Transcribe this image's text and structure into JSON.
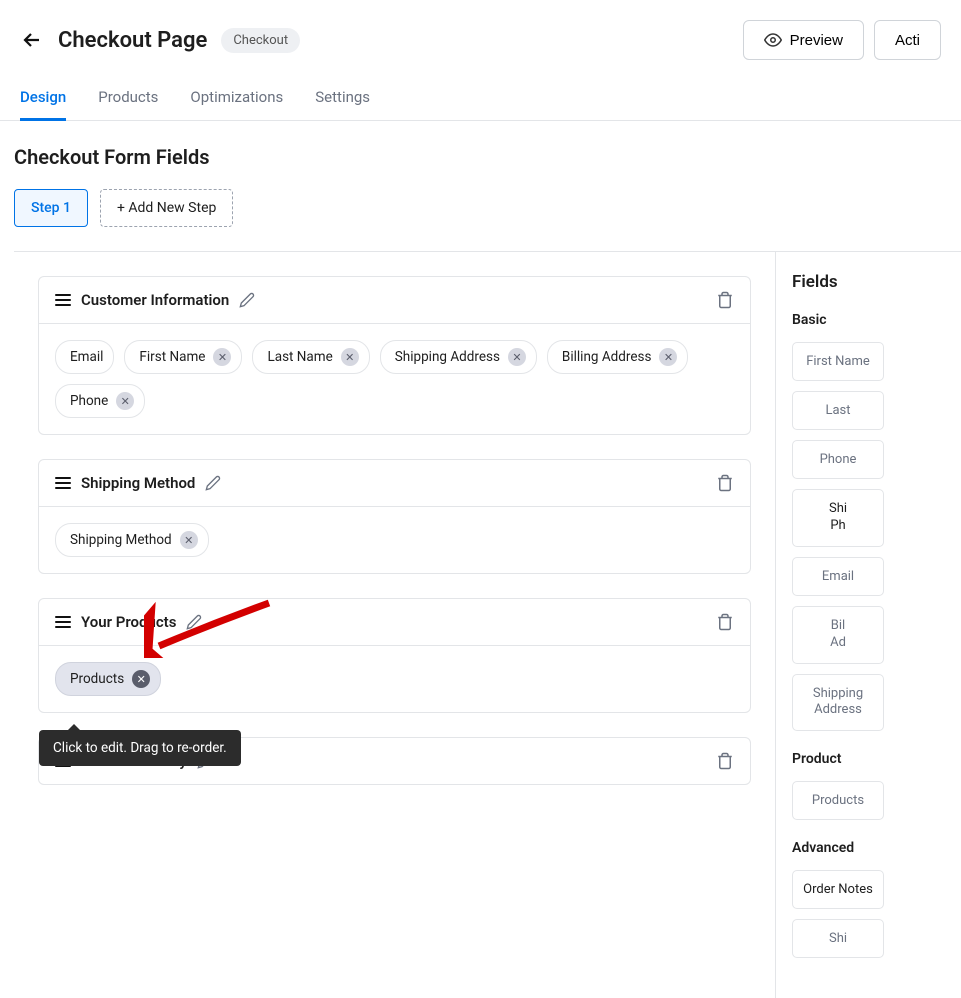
{
  "header": {
    "title": "Checkout Page",
    "badge": "Checkout",
    "preview_label": "Preview",
    "activate_label": "Acti"
  },
  "tabs": [
    {
      "label": "Design",
      "active": true
    },
    {
      "label": "Products",
      "active": false
    },
    {
      "label": "Optimizations",
      "active": false
    },
    {
      "label": "Settings",
      "active": false
    }
  ],
  "section_heading": "Checkout Form Fields",
  "steps": {
    "current": "Step 1",
    "add_label": "+ Add New Step"
  },
  "cards": [
    {
      "title": "Customer Information",
      "fields": [
        {
          "label": "Email"
        },
        {
          "label": "First Name"
        },
        {
          "label": "Last Name"
        },
        {
          "label": "Shipping Address"
        },
        {
          "label": "Billing Address"
        },
        {
          "label": "Phone"
        }
      ]
    },
    {
      "title": "Shipping Method",
      "fields": [
        {
          "label": "Shipping Method"
        }
      ]
    },
    {
      "title": "Your Products",
      "fields": [
        {
          "label": "Products",
          "highlighted": true
        }
      ]
    },
    {
      "title": "Order Summary",
      "fields": []
    }
  ],
  "tooltip_text": "Click to edit. Drag to re-order.",
  "sidebar": {
    "heading": "Fields",
    "groups": [
      {
        "title": "Basic",
        "items": [
          {
            "label": "First Name"
          },
          {
            "label": "Last"
          },
          {
            "label": "Phone"
          },
          {
            "label": "Shi\nPh",
            "dark": true
          },
          {
            "label": "Email"
          },
          {
            "label": "Bil\nAd"
          },
          {
            "label": "Shipping\nAddress",
            "wide": true
          }
        ]
      },
      {
        "title": "Product",
        "items": [
          {
            "label": "Products"
          }
        ]
      },
      {
        "title": "Advanced",
        "items": [
          {
            "label": "Order Notes",
            "dark": true
          },
          {
            "label": "Shi"
          }
        ]
      }
    ]
  }
}
